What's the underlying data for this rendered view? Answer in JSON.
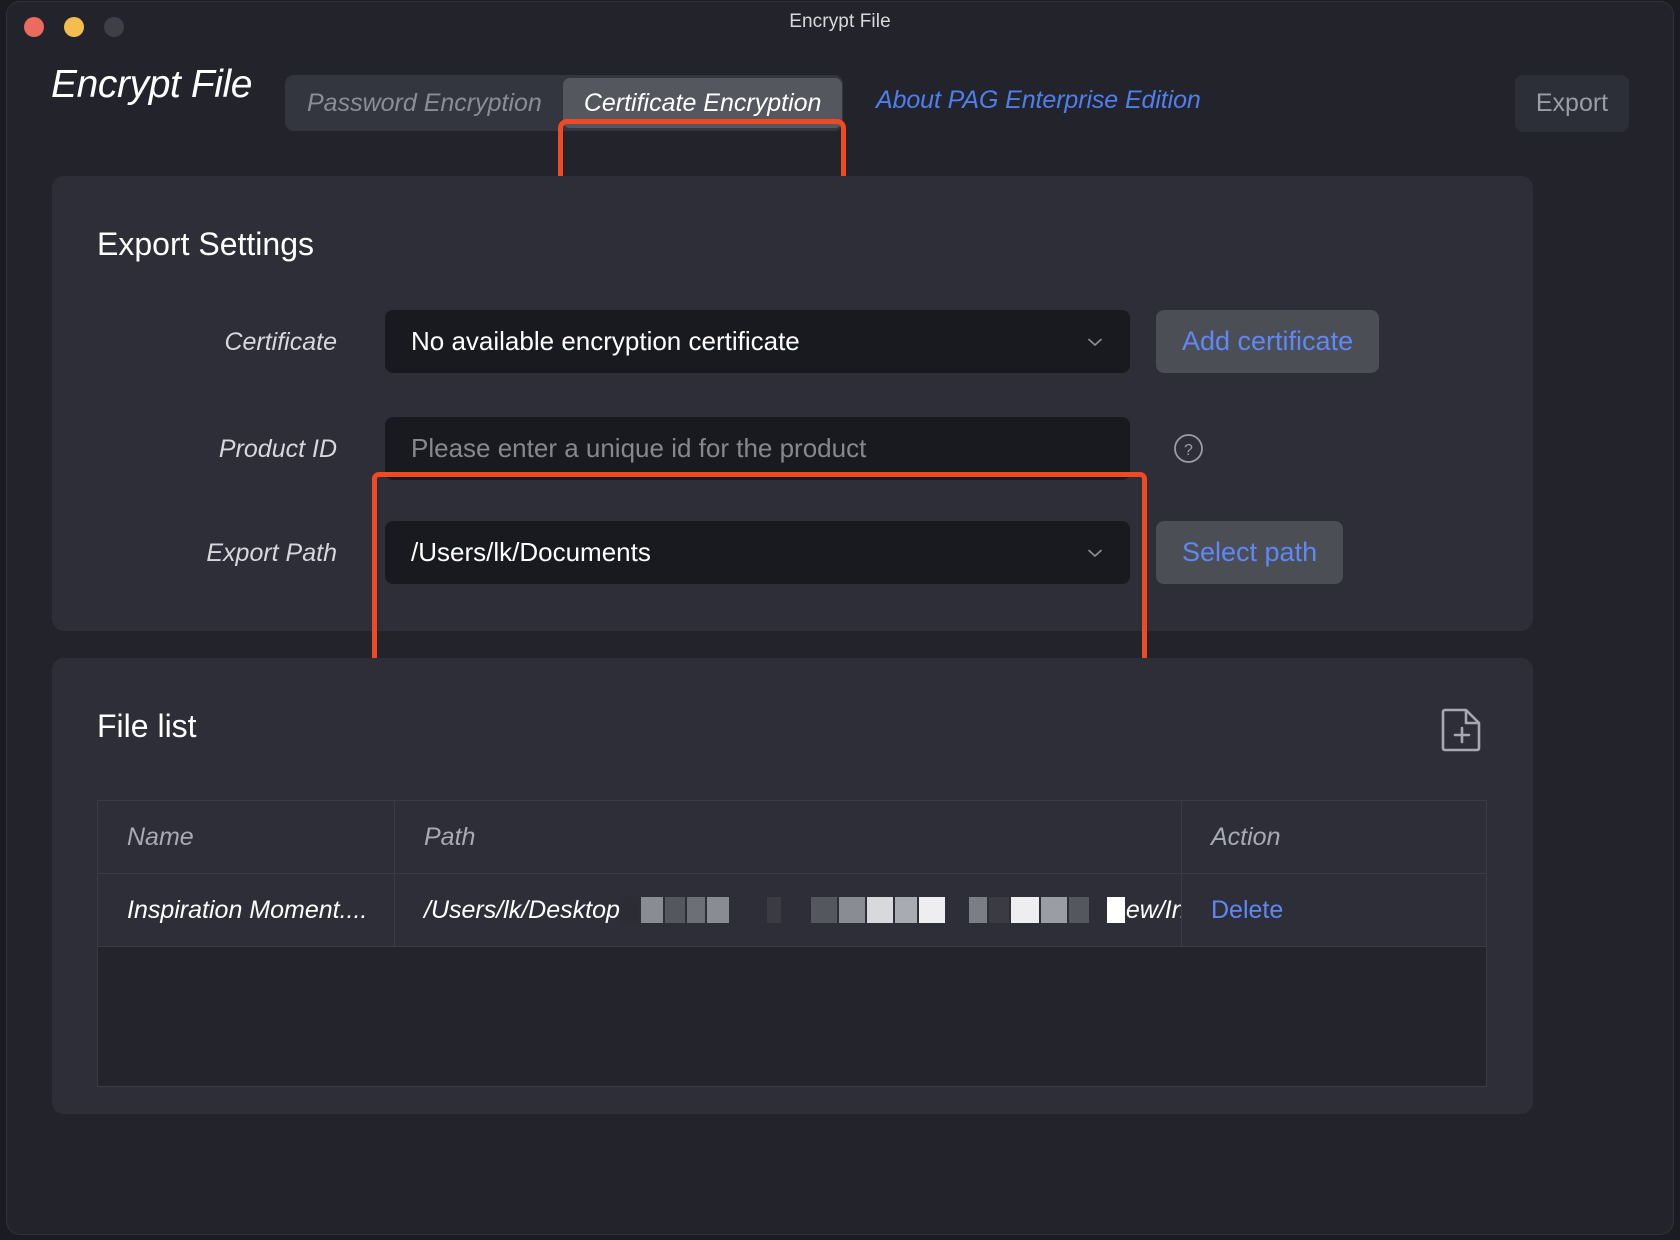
{
  "window": {
    "title": "Encrypt File",
    "traffic_lights": [
      "close-button",
      "minimize-button",
      "maximize-button"
    ]
  },
  "toolbar": {
    "app_title": "Encrypt File",
    "tabs": [
      {
        "label": "Password Encryption",
        "active": false
      },
      {
        "label": "Certificate Encryption",
        "active": true
      }
    ],
    "about_link": "About PAG Enterprise Edition",
    "export_label": "Export"
  },
  "export_settings": {
    "title": "Export Settings",
    "fields": [
      {
        "label": "Certificate",
        "value": "No available encryption certificate",
        "is_placeholder": false,
        "control": "dropdown",
        "action": "Add certificate"
      },
      {
        "label": "Product ID",
        "value": "Please enter a unique id for the product",
        "is_placeholder": true,
        "control": "text",
        "action": null
      },
      {
        "label": "Export Path",
        "value": "/Users/lk/Documents",
        "is_placeholder": false,
        "control": "dropdown",
        "action": "Select path"
      }
    ]
  },
  "file_list": {
    "title": "File list",
    "add_icon": "add-file-icon",
    "columns": [
      "Name",
      "Path",
      "Action"
    ],
    "rows": [
      {
        "name": "Inspiration Moment....",
        "path_prefix": "/Users/lk/Desktop",
        "path_suffix": "ew/Ins...",
        "path_redacted": true,
        "action": "Delete"
      }
    ]
  },
  "colors": {
    "annotation": "#f04a25",
    "link": "#5f88f5",
    "about_link": "#4e7ef0",
    "panel_bg": "#2d2e38",
    "window_bg": "#23242b",
    "field_bg": "#191a1f"
  }
}
